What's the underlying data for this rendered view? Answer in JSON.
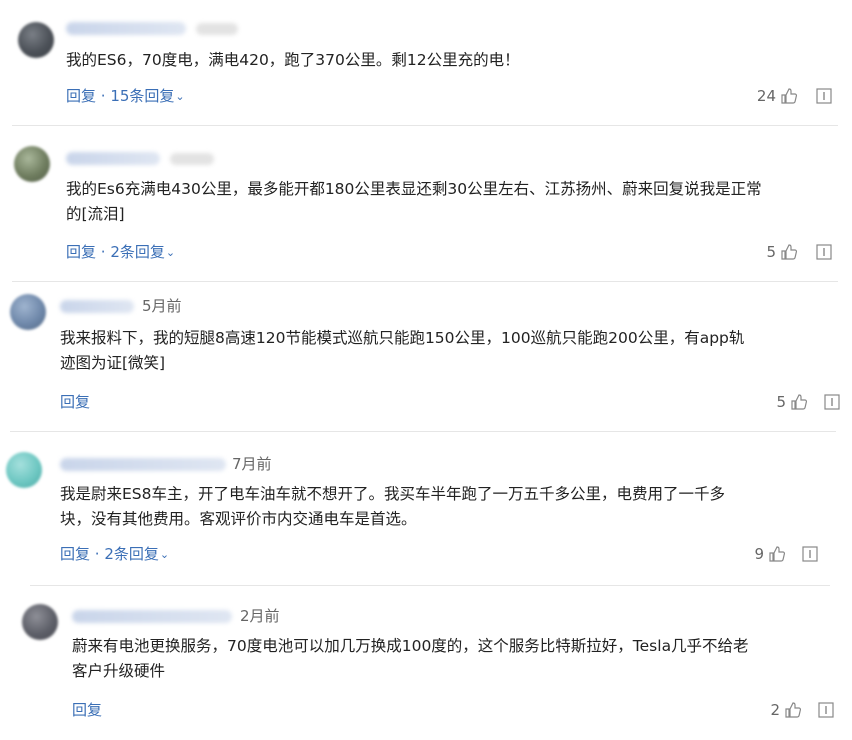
{
  "comments": [
    {
      "time": "",
      "text": "我的ES6，70度电，满电420，跑了370公里。剩12公里充的电！",
      "reply_label": "回复",
      "sep": " · ",
      "replies_label": "15条回复",
      "likes": "24"
    },
    {
      "time": "",
      "text": "我的Es6充满电430公里，最多能开都180公里表显还剩30公里左右、江苏扬州、蔚来回复说我是正常\n的[流泪]",
      "reply_label": "回复",
      "sep": " · ",
      "replies_label": "2条回复",
      "likes": "5"
    },
    {
      "time": "5月前",
      "text": "我来报料下，我的短腿8高速120节能模式巡航只能跑150公里，100巡航只能跑200公里，有app轨\n迹图为证[微笑]",
      "reply_label": "回复",
      "sep": "",
      "replies_label": "",
      "likes": "5"
    },
    {
      "time": "7月前",
      "text": "我是尉来ES8车主，开了电车油车就不想开了。我买车半年跑了一万五千多公里，电费用了一千多\n块，没有其他费用。客观评价市内交通电车是首选。",
      "reply_label": "回复",
      "sep": " · ",
      "replies_label": "2条回复",
      "likes": "9"
    },
    {
      "time": "2月前",
      "text": "蔚来有电池更换服务，70度电池可以加几万换成100度的，这个服务比特斯拉好，Tesla几乎不给老\n客户升级硬件",
      "reply_label": "回复",
      "sep": "",
      "replies_label": "",
      "likes": "2"
    }
  ],
  "icons": {
    "like": "thumbs-up-icon",
    "report": "report-icon",
    "expand": "chevron-down-icon"
  },
  "colors": {
    "link": "#3b6fb6",
    "text": "#222222",
    "muted": "#666666",
    "divider": "#e6e6e6"
  }
}
